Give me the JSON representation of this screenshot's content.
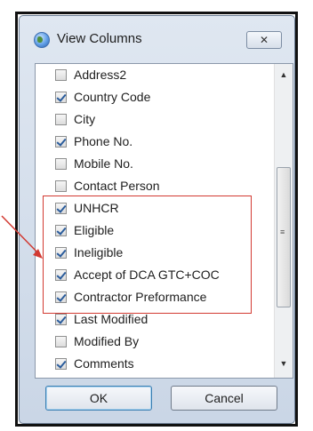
{
  "dialog": {
    "title": "View Columns",
    "close_label": "✕",
    "app_icon": "globe-icon"
  },
  "columns": [
    {
      "label": "Address2",
      "checked": false
    },
    {
      "label": "Country Code",
      "checked": true
    },
    {
      "label": "City",
      "checked": false
    },
    {
      "label": "Phone No.",
      "checked": true
    },
    {
      "label": "Mobile No.",
      "checked": false
    },
    {
      "label": "Contact Person",
      "checked": false
    },
    {
      "label": "UNHCR",
      "checked": true
    },
    {
      "label": "Eligible",
      "checked": true
    },
    {
      "label": "Ineligible",
      "checked": true
    },
    {
      "label": "Accept of DCA GTC+COC",
      "checked": true
    },
    {
      "label": "Contractor Preformance",
      "checked": true
    },
    {
      "label": "Last Modified",
      "checked": true
    },
    {
      "label": "Modified By",
      "checked": false
    },
    {
      "label": "Comments",
      "checked": true
    }
  ],
  "scrollbar": {
    "up": "▲",
    "down": "▼",
    "grip": "≡"
  },
  "buttons": {
    "ok": "OK",
    "cancel": "Cancel"
  },
  "colors": {
    "highlight": "#d23a32",
    "accent": "#2a5c9c"
  }
}
